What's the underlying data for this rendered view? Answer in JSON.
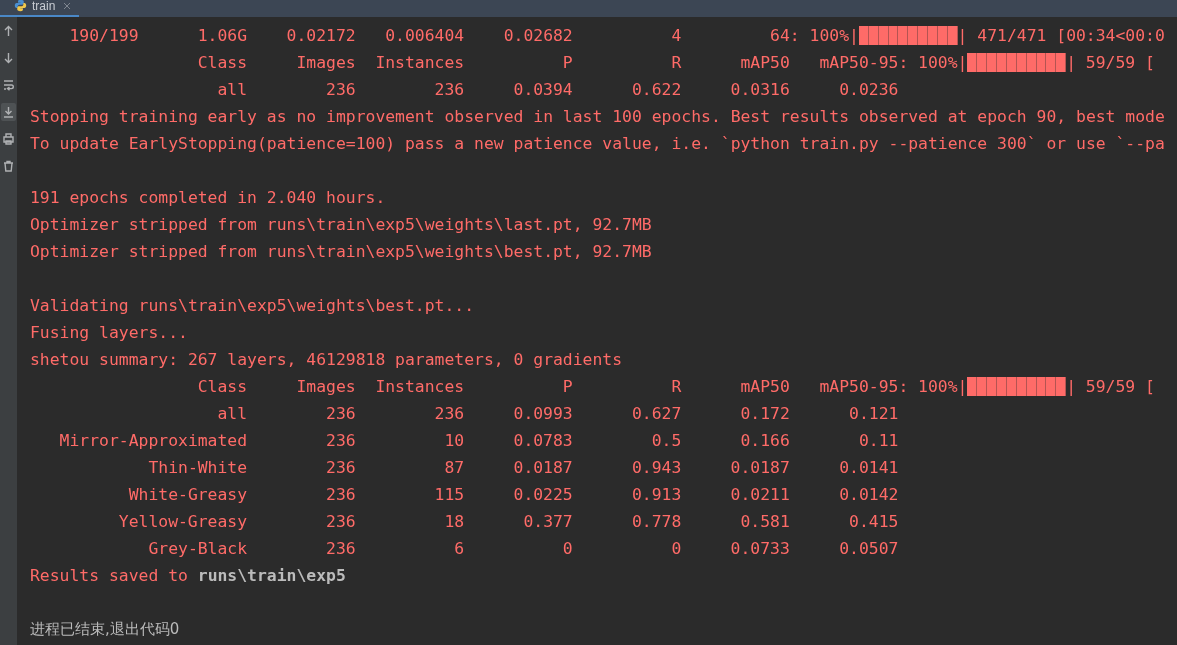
{
  "tab": {
    "title": "train",
    "selected": true
  },
  "gutter_buttons": [
    {
      "kind": "up",
      "selected": false
    },
    {
      "kind": "down",
      "selected": false
    },
    {
      "kind": "wrap",
      "selected": false
    },
    {
      "kind": "scroll-end",
      "selected": true
    },
    {
      "kind": "print",
      "selected": false
    },
    {
      "kind": "trash",
      "selected": false
    }
  ],
  "console": {
    "lines": [
      {
        "kind": "train_row",
        "cells": [
          "190/199",
          "1.06G",
          "0.02172",
          "0.006404",
          "0.02682",
          "4",
          "64"
        ],
        "progress": {
          "label": ": 100%|",
          "level": 1,
          "tail": "| 471/471 [00:34<00:0"
        }
      },
      {
        "kind": "header_row",
        "cells": [
          "Class",
          "Images",
          "Instances",
          "P",
          "R",
          "mAP50",
          "mAP50-95"
        ],
        "progress": {
          "label": ": 100%|",
          "level": 1,
          "tail": "| 59/59 ["
        }
      },
      {
        "kind": "table_row",
        "cells": [
          "all",
          "236",
          "236",
          "0.0394",
          "0.622",
          "0.0316",
          "0.0236"
        ]
      },
      {
        "kind": "text",
        "text": "Stopping training early as no improvement observed in last 100 epochs. Best results observed at epoch 90, best mode"
      },
      {
        "kind": "text",
        "text": "To update EarlyStopping(patience=100) pass a new patience value, i.e. `python train.py --patience 300` or use `--pa"
      },
      {
        "kind": "blank"
      },
      {
        "kind": "text",
        "text": "191 epochs completed in 2.040 hours."
      },
      {
        "kind": "text",
        "text": "Optimizer stripped from runs\\train\\exp5\\weights\\last.pt, 92.7MB"
      },
      {
        "kind": "text",
        "text": "Optimizer stripped from runs\\train\\exp5\\weights\\best.pt, 92.7MB"
      },
      {
        "kind": "blank"
      },
      {
        "kind": "text",
        "text": "Validating runs\\train\\exp5\\weights\\best.pt..."
      },
      {
        "kind": "text",
        "text": "Fusing layers..."
      },
      {
        "kind": "text",
        "text": "shetou summary: 267 layers, 46129818 parameters, 0 gradients"
      },
      {
        "kind": "header_row",
        "cells": [
          "Class",
          "Images",
          "Instances",
          "P",
          "R",
          "mAP50",
          "mAP50-95"
        ],
        "progress": {
          "label": ": 100%|",
          "level": 1,
          "tail": "| 59/59 ["
        }
      },
      {
        "kind": "table_row",
        "cells": [
          "all",
          "236",
          "236",
          "0.0993",
          "0.627",
          "0.172",
          "0.121"
        ]
      },
      {
        "kind": "table_row",
        "cells": [
          "Mirror-Approximated",
          "236",
          "10",
          "0.0783",
          "0.5",
          "0.166",
          "0.11"
        ]
      },
      {
        "kind": "table_row",
        "cells": [
          "Thin-White",
          "236",
          "87",
          "0.0187",
          "0.943",
          "0.0187",
          "0.0141"
        ]
      },
      {
        "kind": "table_row",
        "cells": [
          "White-Greasy",
          "236",
          "115",
          "0.0225",
          "0.913",
          "0.0211",
          "0.0142"
        ]
      },
      {
        "kind": "table_row",
        "cells": [
          "Yellow-Greasy",
          "236",
          "18",
          "0.377",
          "0.778",
          "0.581",
          "0.415"
        ]
      },
      {
        "kind": "table_row",
        "cells": [
          "Grey-Black",
          "236",
          "6",
          "0",
          "0",
          "0.0733",
          "0.0507"
        ]
      },
      {
        "kind": "results",
        "text": "Results saved to **runs\\train\\exp5**"
      },
      {
        "kind": "blank"
      },
      {
        "kind": "exit",
        "text": "进程已结束,退出代码0"
      }
    ]
  }
}
